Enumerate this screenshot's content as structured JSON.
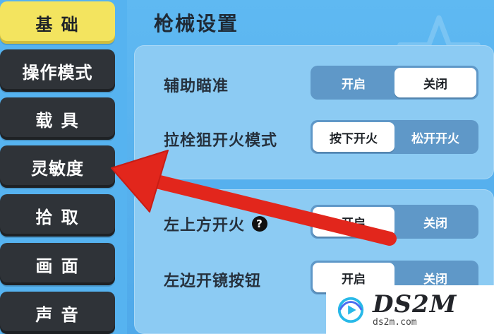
{
  "sidebar": {
    "items": [
      {
        "label": "基 础",
        "active": true
      },
      {
        "label": "操作模式",
        "active": false
      },
      {
        "label": "载 具",
        "active": false
      },
      {
        "label": "灵敏度",
        "active": false
      },
      {
        "label": "拾 取",
        "active": false
      },
      {
        "label": "画 面",
        "active": false
      },
      {
        "label": "声 音",
        "active": false
      }
    ]
  },
  "main": {
    "title": "枪械设置",
    "settings": [
      {
        "label": "辅助瞄准",
        "options": [
          "开启",
          "关闭"
        ],
        "selected": "关闭"
      },
      {
        "label": "拉栓狙开火模式",
        "options": [
          "按下开火",
          "松开开火"
        ],
        "selected": "按下开火"
      },
      {
        "label": "左上方开火",
        "options": [
          "开启",
          "关闭"
        ],
        "selected": "开启",
        "help_icon": "?"
      },
      {
        "label": "左边开镜按钮",
        "options": [
          "开启",
          "关闭"
        ],
        "selected": "开启"
      }
    ]
  },
  "watermark": {
    "brand": "DS2M",
    "domain": "ds2m.com"
  },
  "colors": {
    "active_tab": "#f3e45f",
    "tab_dark": "#2f3338",
    "panel": "#8ccbf3",
    "arrow": "#e2261c"
  },
  "icons": {
    "help": "question-circle-icon",
    "arrow": "red-arrow-annotation",
    "watermark": "ds2m-logo-icon"
  }
}
